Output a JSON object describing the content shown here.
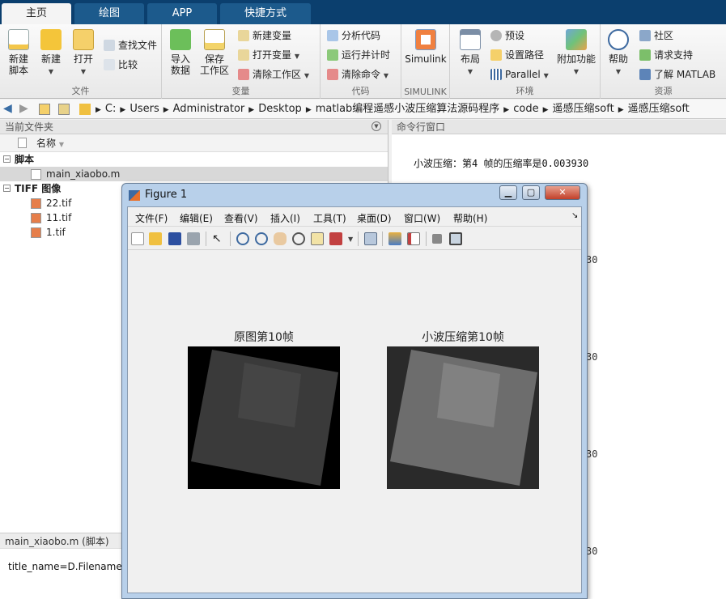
{
  "ribbon": {
    "tabs": [
      {
        "label": "主页",
        "active": true
      },
      {
        "label": "绘图",
        "active": false
      },
      {
        "label": "APP",
        "active": false
      },
      {
        "label": "快捷方式",
        "active": false
      }
    ],
    "groups": {
      "file": {
        "label": "文件",
        "new_script": "新建\n脚本",
        "new": "新建",
        "open": "打开",
        "find_files": "查找文件",
        "compare": "比较"
      },
      "variable": {
        "label": "变量",
        "import": "导入\n数据",
        "save": "保存\n工作区",
        "new_var": "新建变量",
        "open_var": "打开变量",
        "clear_ws": "清除工作区"
      },
      "code": {
        "label": "代码",
        "analyze": "分析代码",
        "run_time": "运行并计时",
        "clear_cmd": "清除命令"
      },
      "simulink": {
        "label": "SIMULINK",
        "simulink": "Simulink"
      },
      "env": {
        "label": "环境",
        "layout": "布局",
        "prefs": "预设",
        "set_path": "设置路径",
        "parallel": "Parallel",
        "addons": "附加功能"
      },
      "resources": {
        "label": "资源",
        "help": "帮助",
        "community": "社区",
        "support": "请求支持",
        "learn": "了解 MATLAB"
      }
    }
  },
  "address": {
    "crumbs": [
      "C:",
      "Users",
      "Administrator",
      "Desktop",
      "matlab编程遥感小波压缩算法源码程序",
      "code",
      "遥感压缩soft",
      "遥感压缩soft"
    ]
  },
  "current_folder": {
    "title": "当前文件夹",
    "column_name": "名称",
    "sections": [
      {
        "label": "脚本",
        "files": [
          {
            "name": "main_xiaobo.m",
            "selected": true
          }
        ]
      },
      {
        "label": "TIFF 图像",
        "files": [
          {
            "name": "22.tif",
            "selected": false
          },
          {
            "name": "11.tif",
            "selected": false
          },
          {
            "name": "1.tif",
            "selected": false
          }
        ]
      }
    ],
    "detail_title": "main_xiaobo.m  (脚本)",
    "detail_body": "title_name=D.Filename;"
  },
  "command_window": {
    "title": "命令行窗口",
    "line": "小波压缩：第4 帧的压缩率是0.003930",
    "fragments": [
      "30",
      "30",
      "30",
      "30"
    ]
  },
  "figure": {
    "title": "Figure 1",
    "menu": [
      "文件(F)",
      "编辑(E)",
      "查看(V)",
      "插入(I)",
      "工具(T)",
      "桌面(D)",
      "窗口(W)",
      "帮助(H)"
    ],
    "axes": [
      {
        "title": "原图第10帧"
      },
      {
        "title": "小波压缩第10帧"
      }
    ]
  },
  "colors": {
    "tabbar": "#0b3f6e",
    "figure_frame": "#b8d0ea",
    "close_button": "#c2402a"
  }
}
